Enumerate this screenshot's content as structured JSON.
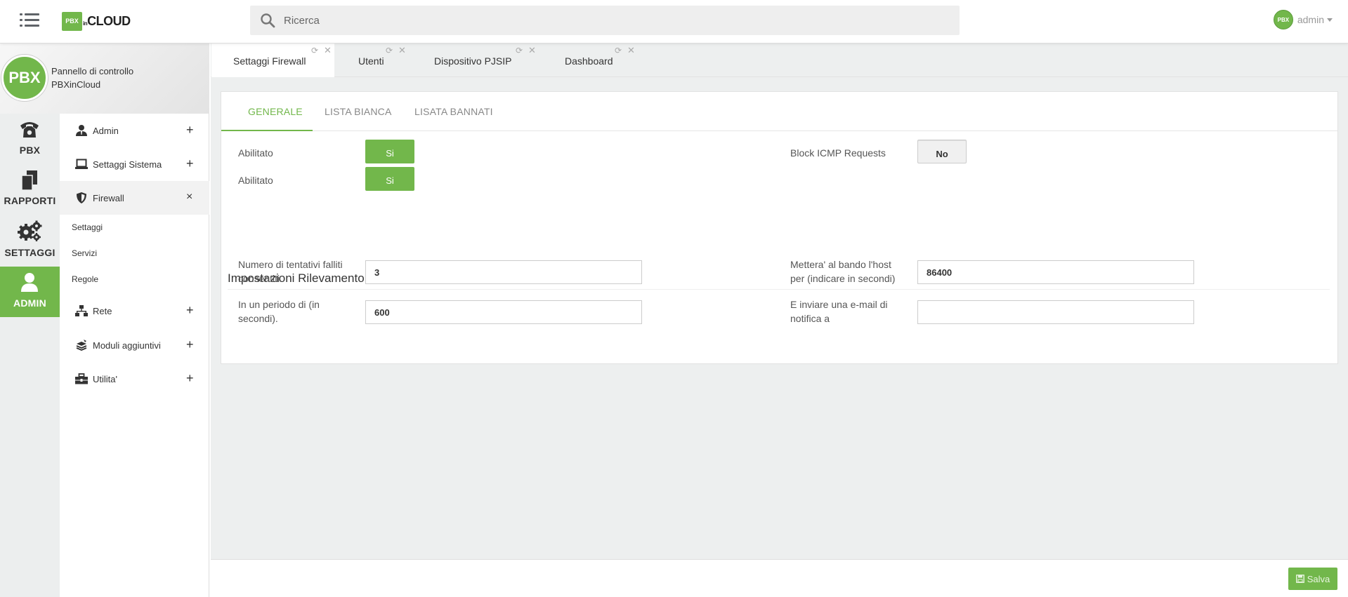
{
  "header": {
    "logo_box": "PBX",
    "logo_in": "in",
    "logo_text": "CLOUD",
    "search_placeholder": "Ricerca",
    "user_avatar": "PBX",
    "user_name": "admin"
  },
  "profile": {
    "avatar": "PBX",
    "line1": "Pannello di controllo",
    "line2": "PBXinCloud"
  },
  "rail": {
    "items": [
      {
        "label": "PBX",
        "icon": "phone-icon"
      },
      {
        "label": "RAPPORTI",
        "icon": "documents-icon"
      },
      {
        "label": "SETTAGGI",
        "icon": "gears-icon"
      },
      {
        "label": "ADMIN",
        "icon": "user-icon"
      }
    ]
  },
  "submenu": {
    "items": [
      {
        "label": "Admin",
        "toggle": "+"
      },
      {
        "label": "Settaggi Sistema",
        "toggle": "+"
      },
      {
        "label": "Firewall",
        "toggle": "×"
      },
      {
        "label": "Rete",
        "toggle": "+"
      },
      {
        "label": "Moduli aggiuntivi",
        "toggle": "+"
      },
      {
        "label": "Utilita'",
        "toggle": "+"
      }
    ],
    "firewall_children": [
      "Settaggi",
      "Servizi",
      "Regole"
    ]
  },
  "tabs": [
    {
      "label": "Settaggi Firewall"
    },
    {
      "label": "Utenti"
    },
    {
      "label": "Dispositivo PJSIP"
    },
    {
      "label": "Dashboard"
    }
  ],
  "card_tabs": [
    "GENERALE",
    "LISTA BIANCA",
    "LISATA BANNATI"
  ],
  "general": {
    "enabled1_label": "Abilitato",
    "enabled1_value": "Si",
    "enabled2_label": "Abilitato",
    "enabled2_value": "Si",
    "icmp_label": "Block ICMP Requests",
    "icmp_value": "No"
  },
  "intrusion": {
    "title": "Impostazioni Rilevamento Intrusioni",
    "attempts_label_1": "Numero di tentativi falliti",
    "attempts_label_2": "consentiti.",
    "attempts_value": "3",
    "period_label_1": "In un periodo di (in",
    "period_label_2": "secondi).",
    "period_value": "600",
    "ban_label_1": "Mettera' al bando l'host",
    "ban_label_2": "per (indicare in secondi)",
    "ban_value": "86400",
    "email_label_1": "E inviare una e-mail di",
    "email_label_2": "notifica a",
    "email_value": ""
  },
  "footer": {
    "save_label": "Salva"
  },
  "colors": {
    "accent": "#72b74b"
  }
}
